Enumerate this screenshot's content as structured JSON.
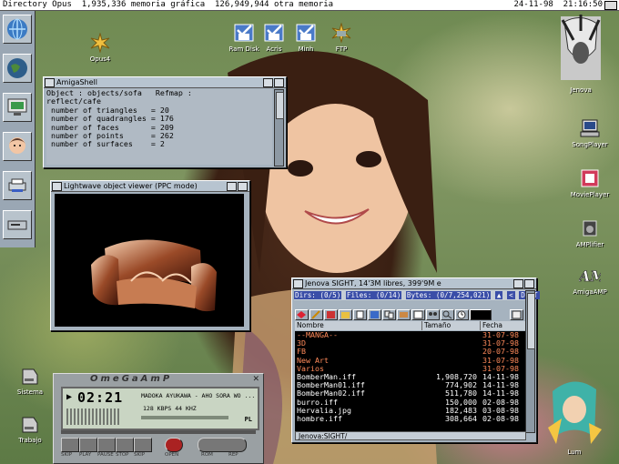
{
  "menubar": {
    "left": "Directory Opus  1,935,336 memoria gráfica  126,949,944 otra memoria",
    "right": "24-11-98  21:16:50"
  },
  "left_toolbar": {
    "buttons": [
      "globe-button",
      "earth-button",
      "monitor-button",
      "face-button",
      "printer-button",
      "drive-button"
    ]
  },
  "desktop_icons": {
    "opus4": "Opus4",
    "ram_disk": "Ram Disk",
    "acris": "Acris",
    "minh": "Minh",
    "ftp": "FTP",
    "jenova": "Jenova",
    "songplayer": "SongPlayer",
    "movieplayer": "MoviePlayer",
    "amplifier": "AMPlifier",
    "amigaamp": "AmigaAMP",
    "sistema": "Sistema",
    "trabajo": "Trabajo",
    "lum": "Lum"
  },
  "shell": {
    "title": "AmigaShell",
    "text": "Object : objects/sofa   Refmap :\nreflect/cafe\n number of triangles   = 20\n number of quadrangles = 176\n number of faces       = 209\n number of points      = 262\n number of surfaces    = 2"
  },
  "viewer": {
    "title": "Lightwave object viewer (PPC mode)"
  },
  "opus": {
    "title": "Jenova SIGHT,  14'3M libres, 399'9M e",
    "dirs": "Dirs: (0/5)",
    "files": "Files: (0/14)",
    "bytes": "Bytes: (0/7,254,021)",
    "dest": "DEST",
    "columns": {
      "name": "Nombre",
      "size": "Tamaño",
      "date": "Fecha"
    },
    "rows": [
      {
        "name": "--MANGA--",
        "size": "",
        "date": "31-07-98",
        "kind": "dir"
      },
      {
        "name": "3D",
        "size": "",
        "date": "31-07-98",
        "kind": "dir"
      },
      {
        "name": "FB",
        "size": "",
        "date": "20-07-98",
        "kind": "dir"
      },
      {
        "name": "New Art",
        "size": "",
        "date": "31-07-98",
        "kind": "dir"
      },
      {
        "name": "Varios",
        "size": "",
        "date": "31-07-98",
        "kind": "dir"
      },
      {
        "name": "BomberMan.iff",
        "size": "1,908,720",
        "date": "14-11-98",
        "kind": "file"
      },
      {
        "name": "BomberMan01.iff",
        "size": "774,902",
        "date": "14-11-98",
        "kind": "file"
      },
      {
        "name": "BomberMan02.iff",
        "size": "511,780",
        "date": "14-11-98",
        "kind": "file"
      },
      {
        "name": "burro.iff",
        "size": "150,000",
        "date": "02-08-98",
        "kind": "file"
      },
      {
        "name": "Hervalia.jpg",
        "size": "182,483",
        "date": "03-08-98",
        "kind": "file"
      },
      {
        "name": "hombre.iff",
        "size": "308,664",
        "date": "02-08-98",
        "kind": "file"
      }
    ],
    "path": "Jenova:SIGHT/"
  },
  "omegaamp": {
    "title": "OmeGaAmP",
    "time": "02:21",
    "track": "MADOKA AYUKAWA - AHO SORA WO ...",
    "bitrate": "128 KBPS 44 KHZ",
    "pl": "PL",
    "buttons": [
      "SKIP",
      "PLAY",
      "PAUSE",
      "STOP",
      "SKIP",
      "OPEN",
      "ROM",
      "REP"
    ]
  },
  "colors": {
    "dir": "#ff8a5a",
    "file": "#ffffff",
    "panel": "#a6b3bf",
    "blue_field": "#3a4ea8"
  }
}
